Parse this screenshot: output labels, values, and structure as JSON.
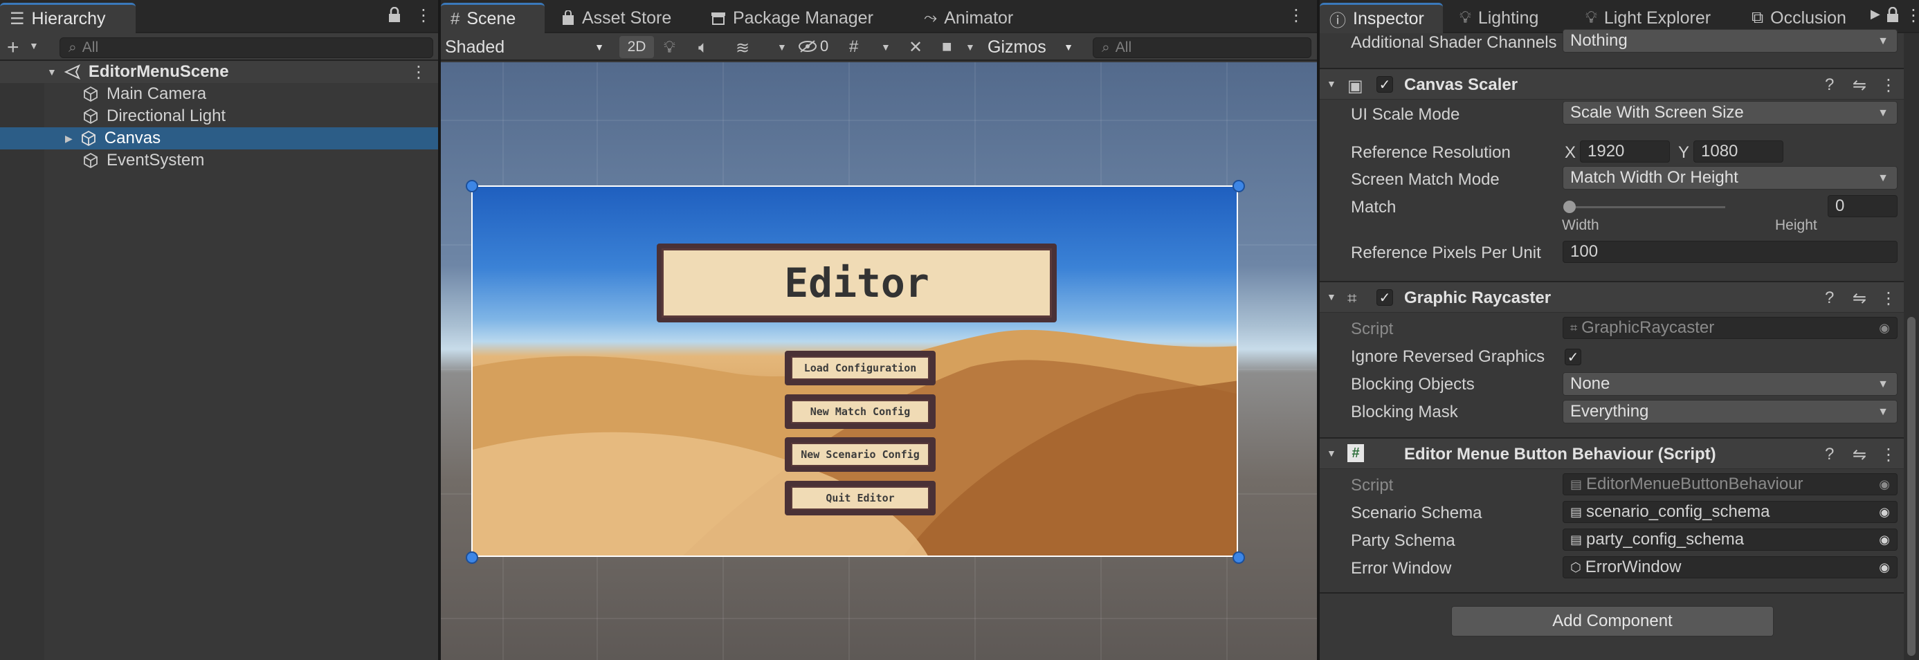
{
  "hierarchy": {
    "tab_label": "Hierarchy",
    "search_placeholder": "All",
    "scene_name": "EditorMenuScene",
    "items": [
      "Main Camera",
      "Directional Light",
      "Canvas",
      "EventSystem"
    ]
  },
  "scene": {
    "tabs": [
      "Scene",
      "Asset Store",
      "Package Manager",
      "Animator"
    ],
    "shading_mode": "Shaded",
    "mode_2d": "2D",
    "hidden_count": "0",
    "gizmos_label": "Gizmos",
    "search_placeholder": "All",
    "game_view": {
      "title": "Editor",
      "buttons": [
        "Load Configuration",
        "New Match Config",
        "New Scenario Config",
        "Quit Editor"
      ]
    }
  },
  "inspector": {
    "tabs": [
      "Inspector",
      "Lighting",
      "Light Explorer",
      "Occlusion"
    ],
    "additional_shader_channels": {
      "label": "Additional Shader Channels",
      "value": "Nothing"
    },
    "canvas_scaler": {
      "title": "Canvas Scaler",
      "ui_scale_mode": {
        "label": "UI Scale Mode",
        "value": "Scale With Screen Size"
      },
      "reference_resolution": {
        "label": "Reference Resolution",
        "x_label": "X",
        "x": "1920",
        "y_label": "Y",
        "y": "1080"
      },
      "screen_match_mode": {
        "label": "Screen Match Mode",
        "value": "Match Width Or Height"
      },
      "match": {
        "label": "Match",
        "value": "0",
        "slider_min_label": "Width",
        "slider_max_label": "Height"
      },
      "reference_ppu": {
        "label": "Reference Pixels Per Unit",
        "value": "100"
      }
    },
    "graphic_raycaster": {
      "title": "Graphic Raycaster",
      "script": {
        "label": "Script",
        "value": "GraphicRaycaster"
      },
      "ignore_reversed": {
        "label": "Ignore Reversed Graphics"
      },
      "blocking_objects": {
        "label": "Blocking Objects",
        "value": "None"
      },
      "blocking_mask": {
        "label": "Blocking Mask",
        "value": "Everything"
      }
    },
    "button_behaviour": {
      "title": "Editor Menue Button Behaviour (Script)",
      "script": {
        "label": "Script",
        "value": "EditorMenueButtonBehaviour"
      },
      "scenario_schema": {
        "label": "Scenario Schema",
        "value": "scenario_config_schema"
      },
      "party_schema": {
        "label": "Party Schema",
        "value": "party_config_schema"
      },
      "error_window": {
        "label": "Error Window",
        "value": "ErrorWindow"
      }
    },
    "add_component": "Add Component"
  },
  "colors": {
    "selection": "#2c5d87",
    "tab_accent": "#3a79bb",
    "button_fill": "#f0dbb5",
    "button_border": "#4a3136"
  }
}
